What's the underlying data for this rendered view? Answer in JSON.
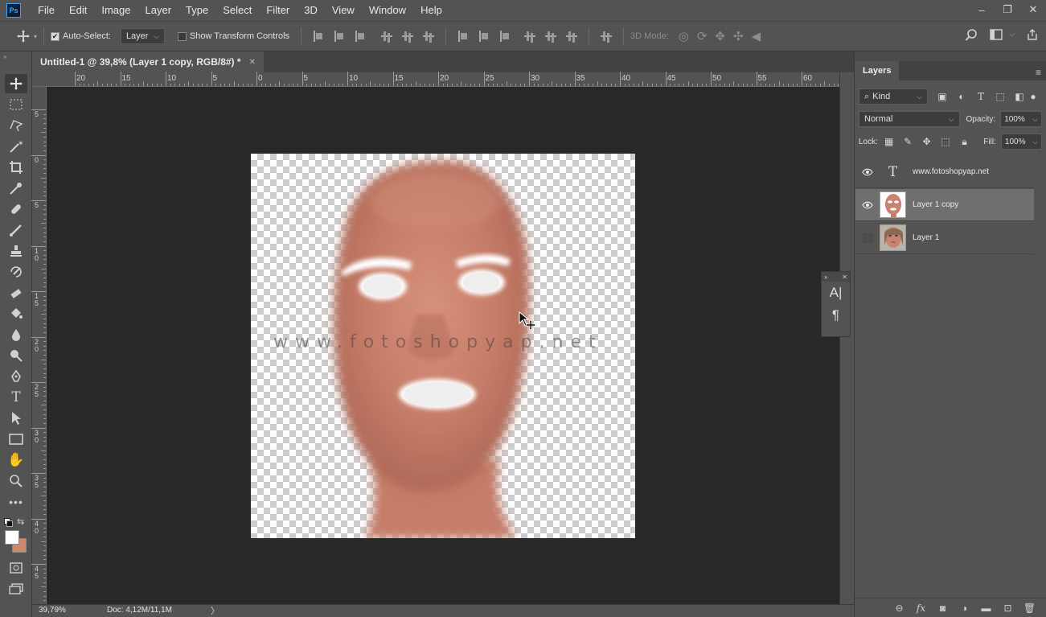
{
  "app": {
    "logo": "Ps",
    "menu": [
      "File",
      "Edit",
      "Image",
      "Layer",
      "Type",
      "Select",
      "Filter",
      "3D",
      "View",
      "Window",
      "Help"
    ],
    "window_controls": {
      "minimize": "–",
      "restore": "❐",
      "close": "✕"
    }
  },
  "options_bar": {
    "auto_select_label": "Auto-Select:",
    "auto_select_checked": true,
    "auto_select_target": "Layer",
    "show_transform_label": "Show Transform Controls",
    "show_transform_checked": false,
    "mode_3d_label": "3D Mode:"
  },
  "document": {
    "tab_title": "Untitled-1 @ 39,8% (Layer 1 copy, RGB/8#) *",
    "watermark_text": "www.fotoshopyap.net"
  },
  "ruler": {
    "top_labels": [
      "20",
      "15",
      "10",
      "5",
      "0",
      "5",
      "10",
      "15",
      "20",
      "25",
      "30",
      "35",
      "40",
      "45",
      "50",
      "55",
      "60"
    ],
    "left_labels": [
      "5",
      "0",
      "5",
      "10",
      "15",
      "20",
      "25",
      "30",
      "35",
      "40",
      "45"
    ]
  },
  "status_bar": {
    "zoom": "39,79%",
    "doc_size": "Doc: 4,12M/11,1M"
  },
  "colors": {
    "foreground": "#ffffff",
    "background": "#d0876c",
    "accent": "#31a8ff"
  },
  "mini_panel": {
    "char_icon": "A|",
    "para_icon": "¶"
  },
  "layers_panel": {
    "tab_label": "Layers",
    "filter_kind": "Kind",
    "blend_mode": "Normal",
    "opacity_label": "Opacity:",
    "opacity_value": "100%",
    "lock_label": "Lock:",
    "fill_label": "Fill:",
    "fill_value": "100%",
    "layers": [
      {
        "name": "www.fotoshopyap.net",
        "type": "text",
        "visible": true,
        "selected": false
      },
      {
        "name": "Layer 1 copy",
        "type": "image",
        "visible": true,
        "selected": true
      },
      {
        "name": "Layer 1",
        "type": "image",
        "visible": false,
        "selected": false
      }
    ]
  }
}
